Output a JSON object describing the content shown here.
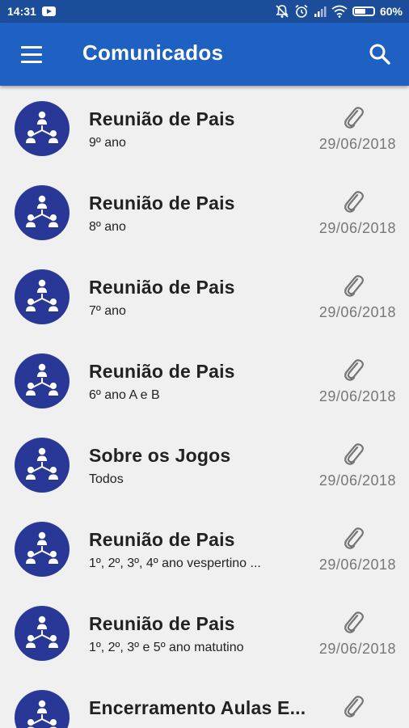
{
  "status": {
    "time": "14:31",
    "battery": "60%"
  },
  "app_bar": {
    "title": "Comunicados"
  },
  "colors": {
    "status_bar": "#1c4d9a",
    "app_bar": "#1f61c2",
    "avatar": "#293896",
    "background": "#f0f0f0"
  },
  "icons": {
    "menu": "hamburger-icon",
    "search": "search-icon",
    "attachment": "paperclip-icon",
    "avatar": "hierarchy-people-icon"
  },
  "items": [
    {
      "title": "Reunião de Pais",
      "subtitle": "9º ano",
      "date": "29/06/2018"
    },
    {
      "title": "Reunião de Pais",
      "subtitle": "8º ano",
      "date": "29/06/2018"
    },
    {
      "title": "Reunião de Pais",
      "subtitle": "7º ano",
      "date": "29/06/2018"
    },
    {
      "title": "Reunião de Pais",
      "subtitle": "6º ano A e B",
      "date": "29/06/2018"
    },
    {
      "title": "Sobre os Jogos",
      "subtitle": "Todos",
      "date": "29/06/2018"
    },
    {
      "title": "Reunião de Pais",
      "subtitle": "1º, 2º, 3º, 4º ano vespertino ...",
      "date": "29/06/2018"
    },
    {
      "title": "Reunião de Pais",
      "subtitle": "1º, 2º, 3º e 5º ano matutino",
      "date": "29/06/2018"
    },
    {
      "title": "Encerramento Aulas E...",
      "subtitle": "",
      "date": ""
    }
  ]
}
